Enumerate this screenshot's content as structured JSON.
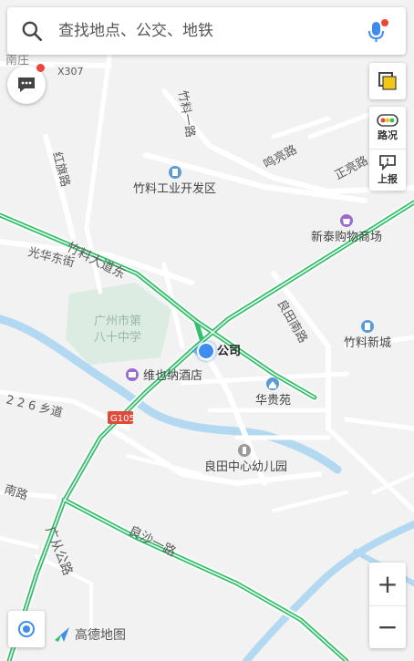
{
  "search": {
    "placeholder": "查找地点、公交、地铁"
  },
  "controls": {
    "traffic_label": "路况",
    "report_label": "上报",
    "zoom_in": "+",
    "zoom_out": "−"
  },
  "brand": {
    "name": "高德地图"
  },
  "map": {
    "road_labels": {
      "zhuliao_dadao_east": "竹料大道东",
      "guanghua_east_st": "光华东街",
      "zhuliao_yi_road": "竹料一路",
      "minghuo_road": "鸣亮路",
      "zhengliang_road": "正亮路",
      "hongxing_road": "红旗路",
      "liangtian_south_road": "良田南路",
      "liangsha_road": "良沙一路",
      "guangcong_road": "广从公路",
      "x307": "X307",
      "g105": "G105",
      "road_226": "2 2 6 乡道",
      "south_road_left": "南路"
    },
    "places": {
      "nanzhuang": "南庄",
      "zhuliao_industrial": "竹料工业开发区",
      "xintai_mall": "新泰购物商场",
      "school": "广州市第八十中学",
      "zhuliao_newtown": "竹料新城",
      "weiyena_hotel": "维也纳酒店",
      "huagui_yuan": "华贵苑",
      "liangtian_kindergarten": "良田中心幼儿园",
      "current_location": "公司"
    },
    "colors": {
      "background": "#f2f2f2",
      "road": "#ffffff",
      "traffic_green": "#34c06a",
      "water": "#b3d9f2",
      "campus": "#dcece2",
      "location_blue": "#3f8cf0"
    }
  }
}
